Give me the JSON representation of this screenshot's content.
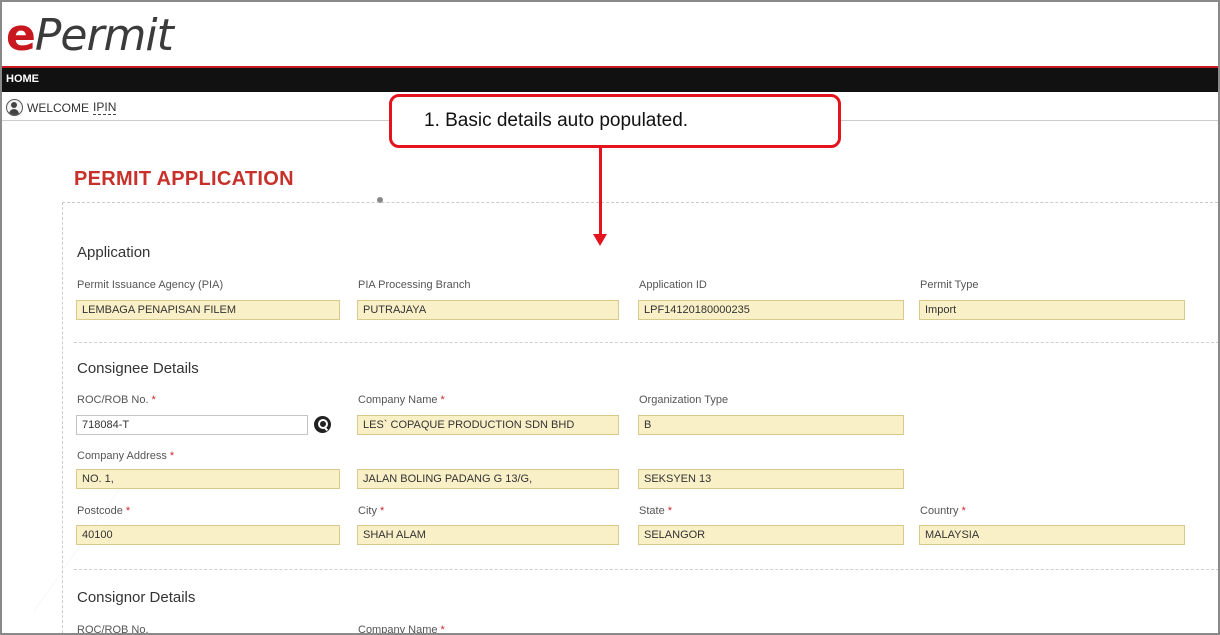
{
  "app": {
    "logo_e": "e",
    "logo_rest": "Permit"
  },
  "nav": {
    "home": "HOME"
  },
  "welcome": {
    "label": "WELCOME",
    "user": "IPIN"
  },
  "callout": {
    "text": "1.   Basic details auto populated.",
    "color": "#e3141d"
  },
  "page": {
    "title": "PERMIT APPLICATION"
  },
  "application": {
    "title": "Application",
    "pia_label": "Permit Issuance Agency (PIA)",
    "pia_value": "LEMBAGA PENAPISAN FILEM",
    "branch_label": "PIA Processing Branch",
    "branch_value": "PUTRAJAYA",
    "app_id_label": "Application ID",
    "app_id_value": "LPF14120180000235",
    "permit_type_label": "Permit Type",
    "permit_type_value": "Import"
  },
  "consignee": {
    "title": "Consignee Details",
    "roc_label": "ROC/ROB No.",
    "roc_value": "718084-T",
    "company_label": "Company Name",
    "company_value": "LES` COPAQUE PRODUCTION SDN BHD",
    "org_type_label": "Organization Type",
    "org_type_value": "B",
    "address_label": "Company Address",
    "address_1": "NO. 1,",
    "address_2": "JALAN BOLING PADANG G 13/G,",
    "address_3": "SEKSYEN 13",
    "postcode_label": "Postcode",
    "postcode_value": "40100",
    "city_label": "City",
    "city_value": "SHAH ALAM",
    "state_label": "State",
    "state_value": "SELANGOR",
    "country_label": "Country",
    "country_value": "MALAYSIA"
  },
  "consignor": {
    "title": "Consignor Details",
    "roc_label": "ROC/ROB No.",
    "company_label": "Company Name"
  },
  "required_marker": "*",
  "colors": {
    "brand_red": "#c8171e",
    "field_bg": "#faf0c8"
  }
}
